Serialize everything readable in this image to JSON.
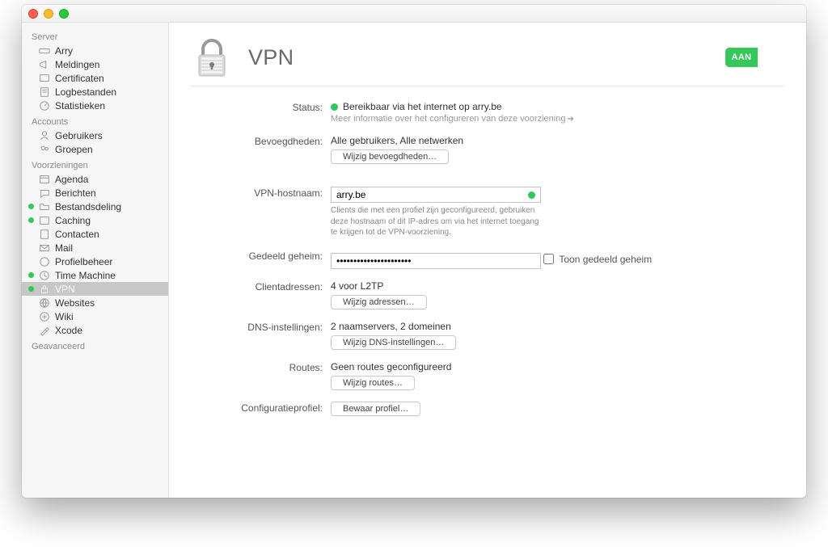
{
  "header": {
    "title": "VPN",
    "toggle_on_label": "AAN"
  },
  "sidebar": {
    "sections": [
      {
        "title": "Server",
        "items": [
          {
            "label": "Arry"
          },
          {
            "label": "Meldingen"
          },
          {
            "label": "Certificaten"
          },
          {
            "label": "Logbestanden"
          },
          {
            "label": "Statistieken"
          }
        ]
      },
      {
        "title": "Accounts",
        "items": [
          {
            "label": "Gebruikers"
          },
          {
            "label": "Groepen"
          }
        ]
      },
      {
        "title": "Voorzieningen",
        "items": [
          {
            "label": "Agenda"
          },
          {
            "label": "Berichten"
          },
          {
            "label": "Bestandsdeling",
            "running": true
          },
          {
            "label": "Caching",
            "running": true
          },
          {
            "label": "Contacten"
          },
          {
            "label": "Mail"
          },
          {
            "label": "Profielbeheer"
          },
          {
            "label": "Time Machine",
            "running": true
          },
          {
            "label": "VPN",
            "running": true,
            "selected": true
          },
          {
            "label": "Websites"
          },
          {
            "label": "Wiki"
          },
          {
            "label": "Xcode"
          }
        ]
      },
      {
        "title": "Geavanceerd",
        "items": []
      }
    ]
  },
  "status": {
    "label": "Status:",
    "text": "Bereikbaar via het internet op arry.be",
    "info": "Meer informatie over het configureren van deze voorziening"
  },
  "permissions": {
    "label": "Bevoegdheden:",
    "value": "Alle gebruikers, Alle netwerken",
    "button": "Wijzig bevoegdheden…"
  },
  "hostname": {
    "label": "VPN-hostnaam:",
    "value": "arry.be",
    "hint": "Clients die met een profiel zijn geconfigureerd, gebruiken deze hostnaam of dit IP-adres om via het internet toegang te krijgen tot de VPN-voorziening."
  },
  "secret": {
    "label": "Gedeeld geheim:",
    "value": "••••••••••••••••••••••",
    "checkbox": "Toon gedeeld geheim"
  },
  "clients": {
    "label": "Clientadressen:",
    "value": "4 voor L2TP",
    "button": "Wijzig adressen…"
  },
  "dns": {
    "label": "DNS-instellingen:",
    "value": "2 naamservers, 2 domeinen",
    "button": "Wijzig DNS-instellingen…"
  },
  "routes": {
    "label": "Routes:",
    "value": "Geen routes geconfigureerd",
    "button": "Wijzig routes…"
  },
  "profile": {
    "label": "Configuratieprofiel:",
    "button": "Bewaar profiel…"
  }
}
